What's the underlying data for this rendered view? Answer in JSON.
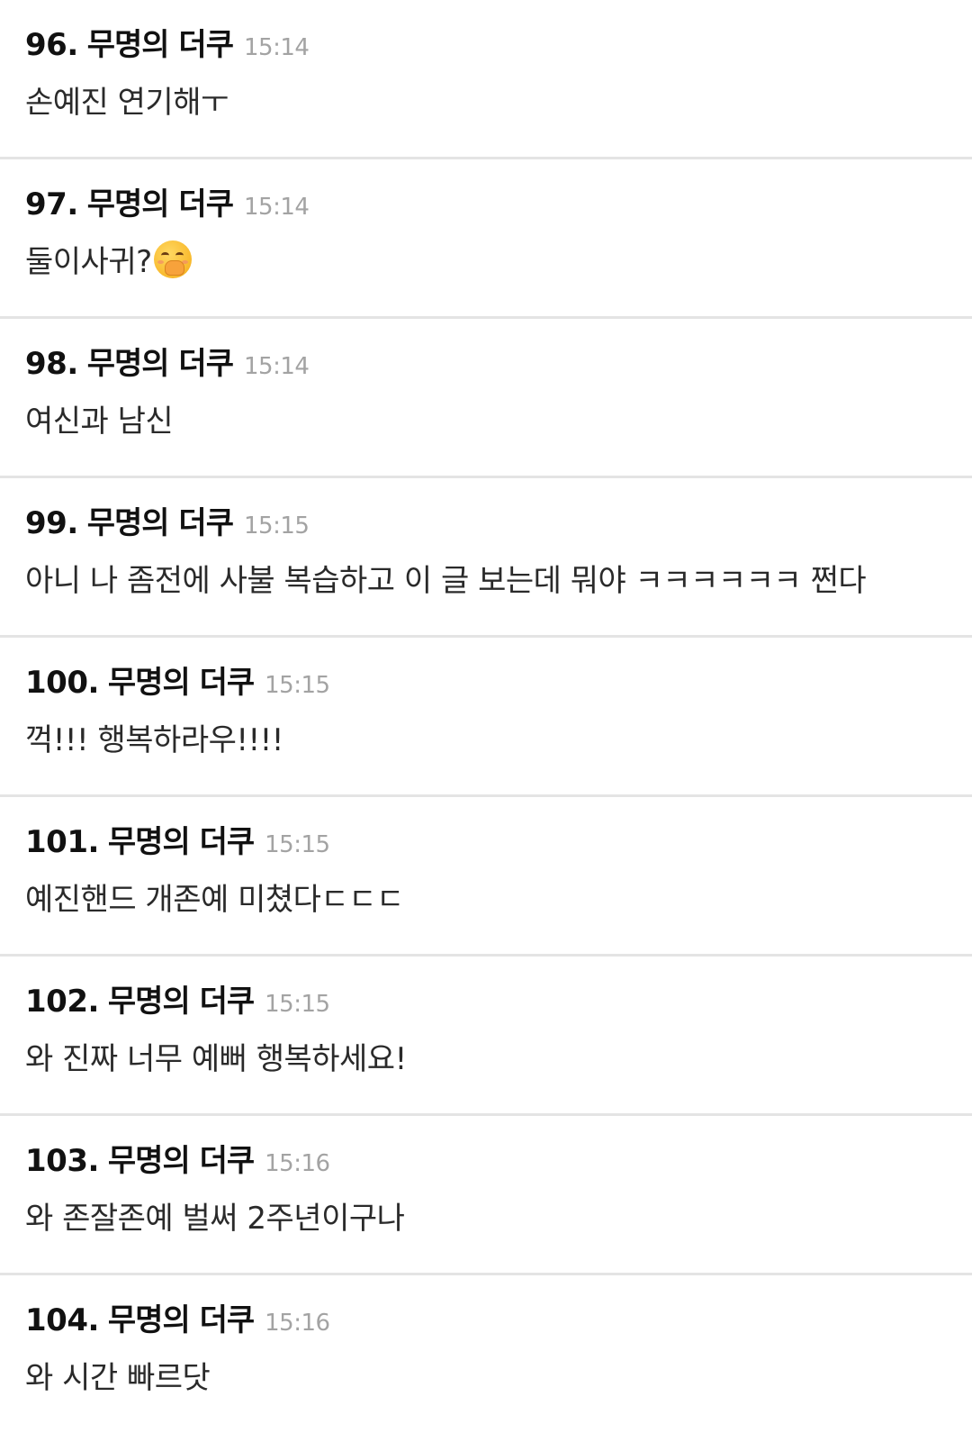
{
  "comments": [
    {
      "num": "96.",
      "author": "무명의 더쿠",
      "time": "15:14",
      "text": "손예진 연기해ㅜ"
    },
    {
      "num": "97.",
      "author": "무명의 더쿠",
      "time": "15:14",
      "text": "둘이사귀?",
      "emoji": "hand-over-mouth-face-icon"
    },
    {
      "num": "98.",
      "author": "무명의 더쿠",
      "time": "15:14",
      "text": "여신과 남신"
    },
    {
      "num": "99.",
      "author": "무명의 더쿠",
      "time": "15:15",
      "text": "아니 나 좀전에 사불 복습하고 이 글 보는데 뭐야 ㅋㅋㅋㅋㅋㅋ 쩐다"
    },
    {
      "num": "100.",
      "author": "무명의 더쿠",
      "time": "15:15",
      "text": "꺽!!! 행복하라우!!!!"
    },
    {
      "num": "101.",
      "author": "무명의 더쿠",
      "time": "15:15",
      "text": "예진핸드 개존예 미쳤다ㄷㄷㄷ"
    },
    {
      "num": "102.",
      "author": "무명의 더쿠",
      "time": "15:15",
      "text": "와 진짜 너무 예뻐 행복하세요!"
    },
    {
      "num": "103.",
      "author": "무명의 더쿠",
      "time": "15:16",
      "text": "와 존잘존예 벌써 2주년이구나"
    },
    {
      "num": "104.",
      "author": "무명의 더쿠",
      "time": "15:16",
      "text": "와 시간 빠르닷"
    }
  ],
  "colors": {
    "text": "#1c1c1c",
    "time": "#a3a3a3",
    "divider": "#e4e4e4",
    "background": "#ffffff"
  }
}
